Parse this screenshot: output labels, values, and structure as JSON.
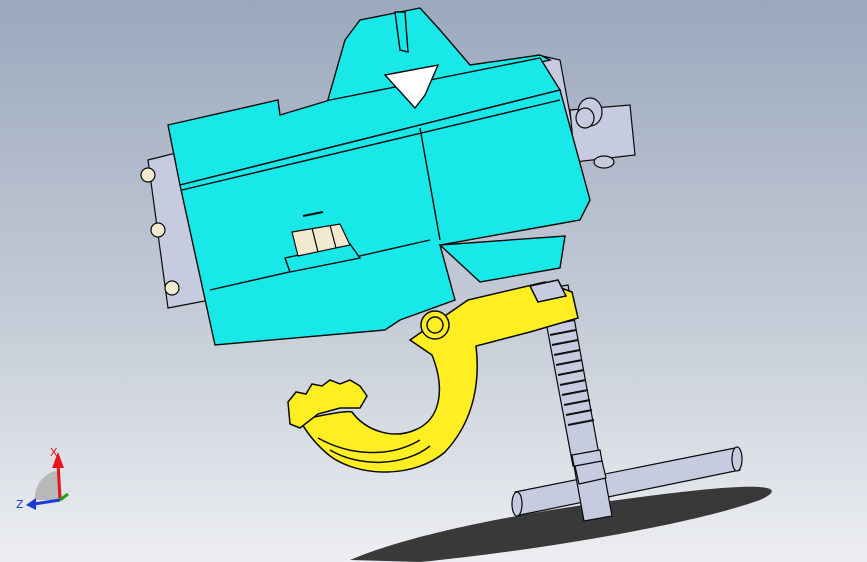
{
  "viewport": {
    "colors": {
      "body": "#19e8e8",
      "hook": "#ffee22",
      "steel": "#c6cbe0",
      "nut": "#f3e9cf",
      "outline": "#0a0a0a"
    }
  },
  "triad": {
    "x_label": "X",
    "z_label": "Z",
    "x_color": "#e8141e",
    "z_color": "#1d3ad6",
    "y_color": "#1aa51a"
  }
}
